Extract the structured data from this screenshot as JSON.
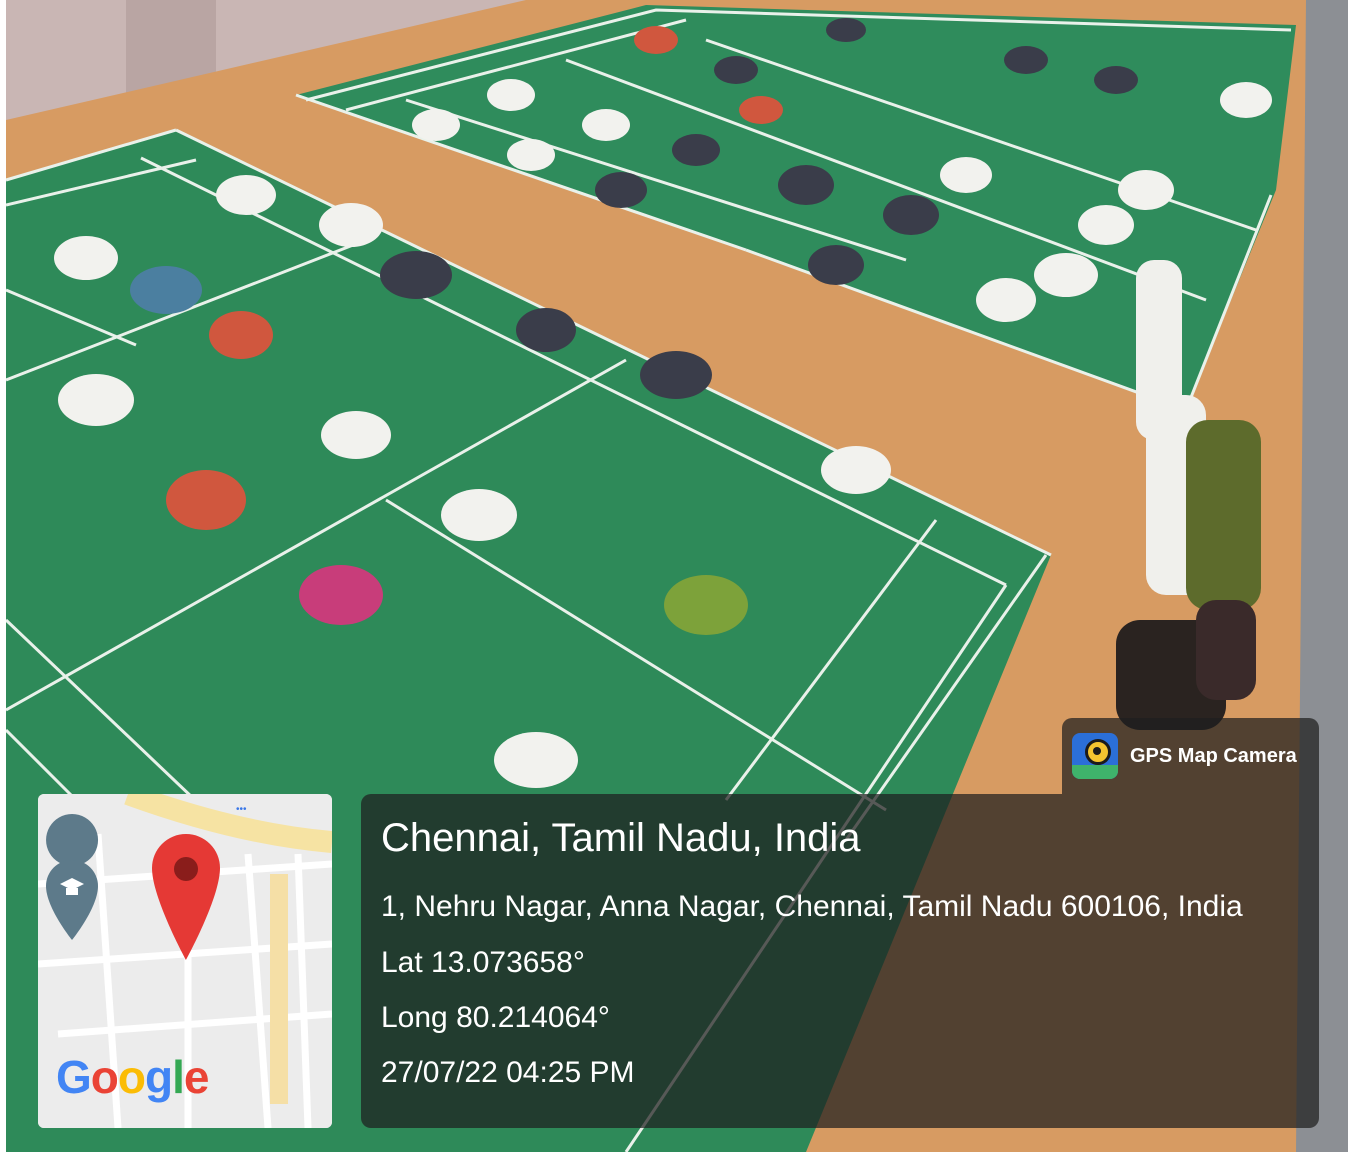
{
  "stamp": {
    "app_name": "GPS Map Camera",
    "place": "Chennai, Tamil Nadu, India",
    "address": "1, Nehru Nagar, Anna Nagar, Chennai, Tamil Nadu 600106, India",
    "lat": "Lat 13.073658°",
    "long": "Long 80.214064°",
    "datetime": "27/07/22 04:25 PM"
  },
  "map": {
    "logo_letters": [
      "G",
      "o",
      "o",
      "g",
      "l",
      "e"
    ],
    "logo_colors": [
      "#4285f4",
      "#ea4335",
      "#fbbc05",
      "#4285f4",
      "#34a853",
      "#ea4335"
    ],
    "more_dots": "•••"
  },
  "colors": {
    "court_green": "#2f8c5c",
    "floor_wood": "#d79b62",
    "court_line": "#e9f1ea",
    "pin_red": "#e53935",
    "stamp_bg": "rgba(30,30,30,0.72)"
  }
}
